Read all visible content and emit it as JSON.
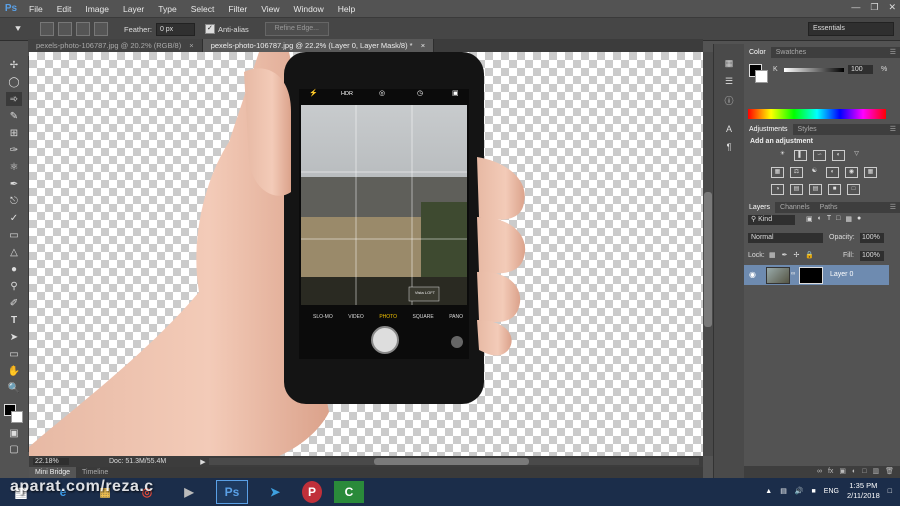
{
  "menu": [
    "File",
    "Edit",
    "Image",
    "Layer",
    "Type",
    "Select",
    "Filter",
    "View",
    "Window",
    "Help"
  ],
  "app_logo": "Ps",
  "options": {
    "feather_label": "Feather:",
    "feather_value": "0 px",
    "antialias_label": "Anti-alias",
    "refine_label": "Refine Edge...",
    "workspace": "Essentials"
  },
  "tabs": [
    {
      "label": "pexels-photo-106787.jpg @ 20.2% (RGB/8)",
      "close": "×"
    },
    {
      "label": "pexels-photo-106787.jpg @ 22.2% (Layer 0, Layer Mask/8) *",
      "close": "×"
    }
  ],
  "status": {
    "zoom": "22.18%",
    "doc": "Doc: 51.3M/55.4M"
  },
  "bottom_tabs": [
    "Mini Bridge",
    "Timeline"
  ],
  "phone": {
    "hdr": "HDR",
    "modes": [
      "SLO-MO",
      "VIDEO",
      "PHOTO",
      "SQUARE",
      "PANO"
    ],
    "sign": "Vista LOFT"
  },
  "color_panel": {
    "tabs": [
      "Color",
      "Swatches"
    ],
    "channel": "K",
    "value": "100",
    "unit": "%"
  },
  "adjustments_panel": {
    "tabs": [
      "Adjustments",
      "Styles"
    ],
    "heading": "Add an adjustment"
  },
  "layers_panel": {
    "tabs": [
      "Layers",
      "Channels",
      "Paths"
    ],
    "kind": "Kind",
    "blend": "Normal",
    "opacity_label": "Opacity:",
    "opacity_value": "100%",
    "lock_label": "Lock:",
    "fill_label": "Fill:",
    "fill_value": "100%",
    "layer_name": "Layer 0"
  },
  "taskbar": {
    "watermark": "aparat.com/reza.c",
    "lang": "ENG",
    "time": "1:35 PM",
    "date": "2/11/2018"
  },
  "colors": {
    "accent": "#5aa0e6",
    "layer_selected": "#6e8bb0",
    "taskbar": "#1b2d4a"
  }
}
